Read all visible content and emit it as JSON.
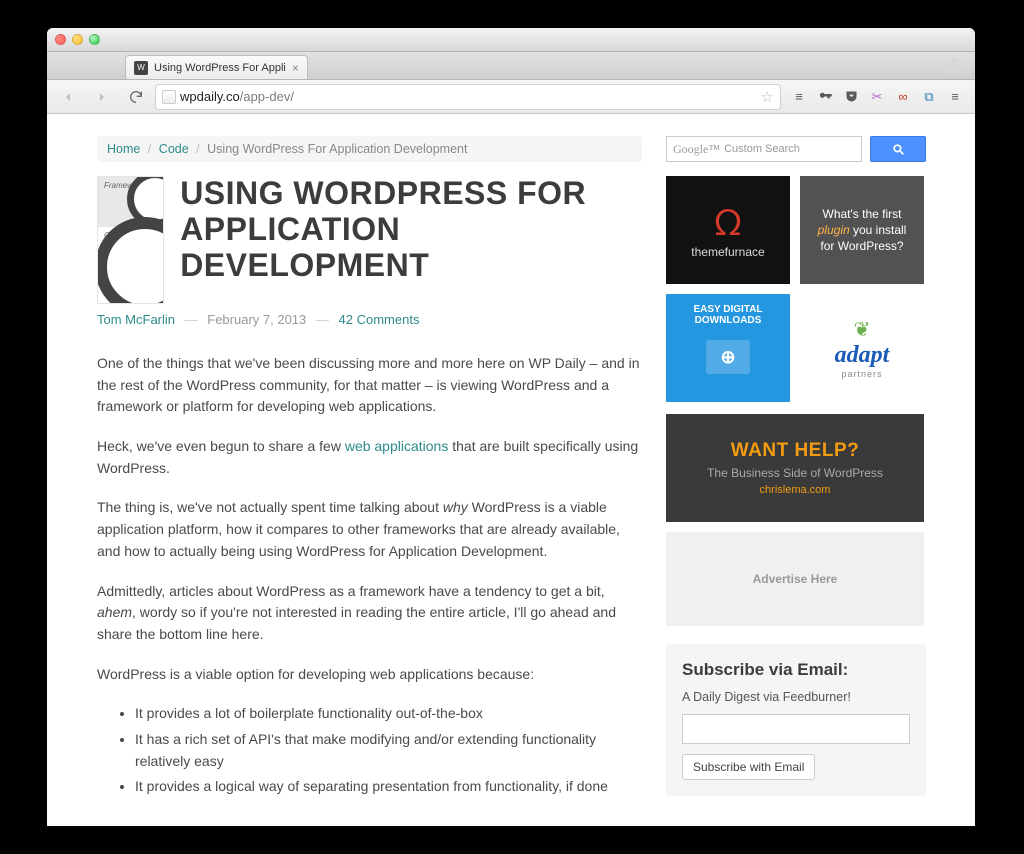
{
  "browser": {
    "tab_title": "Using WordPress For Appli",
    "url_host": "wpdaily.co",
    "url_path": "/app-dev/"
  },
  "breadcrumb": {
    "home": "Home",
    "code": "Code",
    "current": "Using WordPress For Application Development"
  },
  "article": {
    "thumb_labels": {
      "top": "Framework",
      "bottom": "Core"
    },
    "title": "USING WORDPRESS FOR APPLICATION DEVELOPMENT",
    "author": "Tom McFarlin",
    "date": "February 7, 2013",
    "comments": "42 Comments",
    "p1": "One of the things that we've been discussing more and more here on WP Daily – and in the rest of the WordPress community, for that matter – is viewing WordPress and a framework or platform for developing web applications.",
    "p2a": "Heck, we've even begun to share a few ",
    "p2link": "web applications",
    "p2b": " that are built specifically using WordPress.",
    "p3a": "The thing is, we've not actually spent time talking about ",
    "p3em": "why",
    "p3b": " WordPress is a viable application platform, how it compares to other frameworks that are already available, and how to actually being using WordPress for Application Development.",
    "p4a": "Admittedly, articles about WordPress as a framework have a tendency to get a bit, ",
    "p4em": "ahem",
    "p4b": ", wordy so if you're not interested in reading the entire article, I'll go ahead and share the bottom line here.",
    "p5": "WordPress is a viable option for developing web applications because:",
    "bullets": [
      "It provides a lot of boilerplate functionality out-of-the-box",
      "It has a rich set of API's that make modifying and/or extending functionality relatively easy",
      "It provides a logical way of separating presentation from functionality, if done"
    ]
  },
  "sidebar": {
    "search_placeholder": "Custom Search",
    "search_brand": "Google™",
    "ads": {
      "tf": "themefurnace",
      "gray_pre": "What's the first ",
      "gray_em": "plugin",
      "gray_post": " you install for WordPress?",
      "edd": "EASY DIGITAL DOWNLOADS",
      "adapt": "adapt",
      "adapt_sub": "partners",
      "help_h": "WANT HELP?",
      "help_sub": "The Business Side of WordPress",
      "help_link": "chrislema.com",
      "placeholder": "Advertise Here"
    },
    "subscribe": {
      "heading": "Subscribe via Email:",
      "blurb": "A Daily Digest via Feedburner!",
      "button": "Subscribe with Email"
    }
  }
}
